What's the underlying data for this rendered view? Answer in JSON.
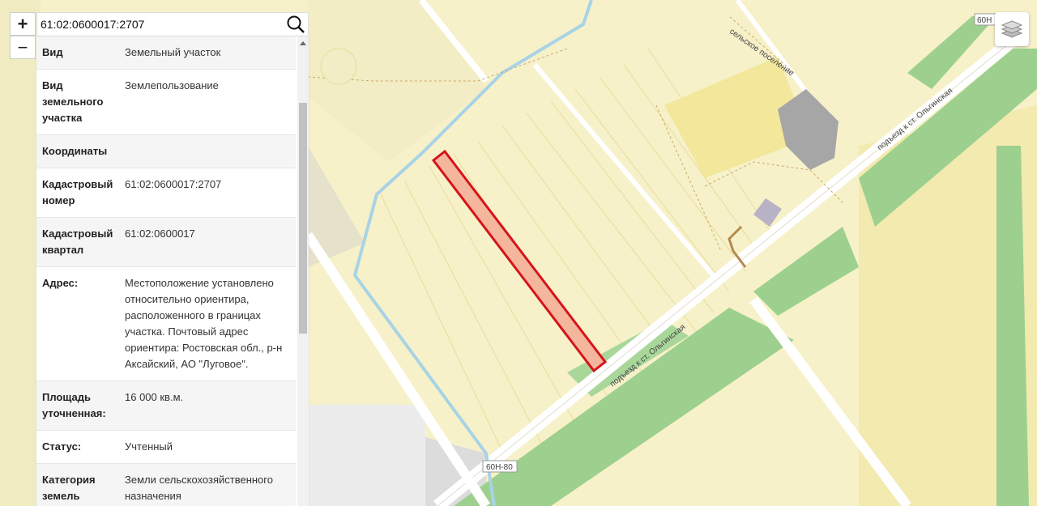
{
  "search": {
    "value": "61:02:0600017:2707"
  },
  "zoom": {
    "in_label": "+",
    "out_label": "−"
  },
  "info_rows": [
    {
      "key": "Вид",
      "value": "Земельный участок"
    },
    {
      "key": "Вид земельного участка",
      "value": "Землепользование"
    },
    {
      "key": "Координаты",
      "value": ""
    },
    {
      "key": "Кадастровый номер",
      "value": "61:02:0600017:2707"
    },
    {
      "key": "Кадастровый квартал",
      "value": "61:02:0600017"
    },
    {
      "key": "Адрес:",
      "value": "Местоположение установлено относительно ориентира, расположенного в границах участка. Почтовый адрес ориентира: Ростовская обл., р-н Аксайский, АО \"Луговое\"."
    },
    {
      "key": "Площадь уточненная:",
      "value": "16 000 кв.м."
    },
    {
      "key": "Статус:",
      "value": "Учтенный"
    },
    {
      "key": "Категория земель",
      "value": "Земли сельскохозяйственного назначения"
    }
  ],
  "map": {
    "road_labels": {
      "main_road_1": "подъезд к ст. Ольгинская",
      "main_road_2": "подъезд к ст. Ольгинская",
      "route_60n80": "60Н-80",
      "route_60n": "60Н",
      "settlement": "сельское поселение"
    },
    "colors": {
      "parcel_fill": "#f4b69c",
      "parcel_stroke": "#d6141b",
      "land": "#f7f1c9",
      "green": "#9dd08e"
    }
  }
}
